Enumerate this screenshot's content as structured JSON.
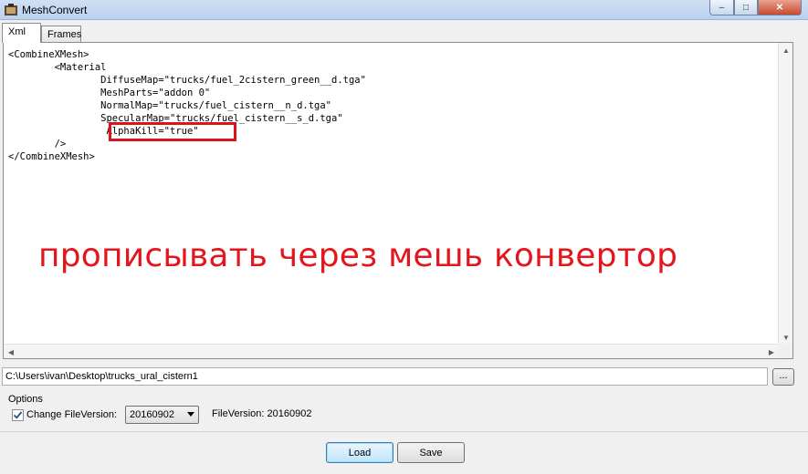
{
  "window": {
    "title": "MeshConvert",
    "controls": {
      "minimize": "‒",
      "maximize": "□",
      "close": "✕"
    }
  },
  "tabs": [
    {
      "label": "Xml",
      "active": true
    },
    {
      "label": "Frames",
      "active": false
    }
  ],
  "editor": {
    "lines": [
      "<CombineXMesh>",
      "        <Material",
      "                DiffuseMap=\"trucks/fuel_2cistern_green__d.tga\"",
      "                MeshParts=\"addon 0\"",
      "                NormalMap=\"trucks/fuel_cistern__n_d.tga\"",
      "                SpecularMap=\"trucks/fuel_cistern__s_d.tga\"",
      "                 AlphaKill=\"true\"",
      "        />",
      "</CombineXMesh>"
    ],
    "highlight_color": "#d9141b",
    "annotation": "прописывать через мешь конвертор",
    "annotation_color": "#e3161d"
  },
  "path": {
    "value": "C:\\Users\\ivan\\Desktop\\trucks_ural_cistern1",
    "browse_label": "..."
  },
  "options": {
    "group_label": "Options",
    "change_file_version": {
      "label": "Change FileVersion:",
      "checked": true
    },
    "version_select": {
      "selected": "20160902"
    },
    "file_version_text": "FileVersion: 20160902"
  },
  "buttons": {
    "load_label": "Load",
    "save_label": "Save"
  }
}
